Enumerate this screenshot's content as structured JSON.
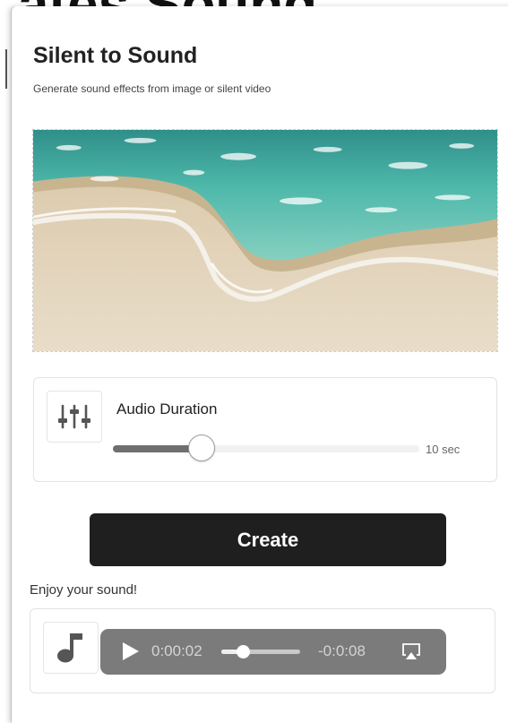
{
  "background": {
    "heading": "ates Sound"
  },
  "dialog": {
    "title": "Silent to Sound",
    "subtitle": "Generate sound effects from image or silent video"
  },
  "image": {
    "icon": "beach-shoreline-image"
  },
  "duration": {
    "icon": "sliders-icon",
    "label": "Audio Duration",
    "value": 10,
    "value_text": "10 sec",
    "position_fraction": 0.29
  },
  "actions": {
    "create_label": "Create"
  },
  "result": {
    "label": "Enjoy your sound!",
    "icon": "music-note-icon",
    "player": {
      "current_time": "0:00:02",
      "remaining_time": "-0:0:08",
      "progress_fraction": 0.27,
      "play_icon": "play-icon",
      "airplay_icon": "airplay-icon"
    }
  },
  "colors": {
    "button_bg": "#1f1f1f",
    "player_bg": "#7b7b7b",
    "slider_fill": "#6f6f6f",
    "water": "#3fb2a6",
    "sand": "#e3d4bd"
  }
}
